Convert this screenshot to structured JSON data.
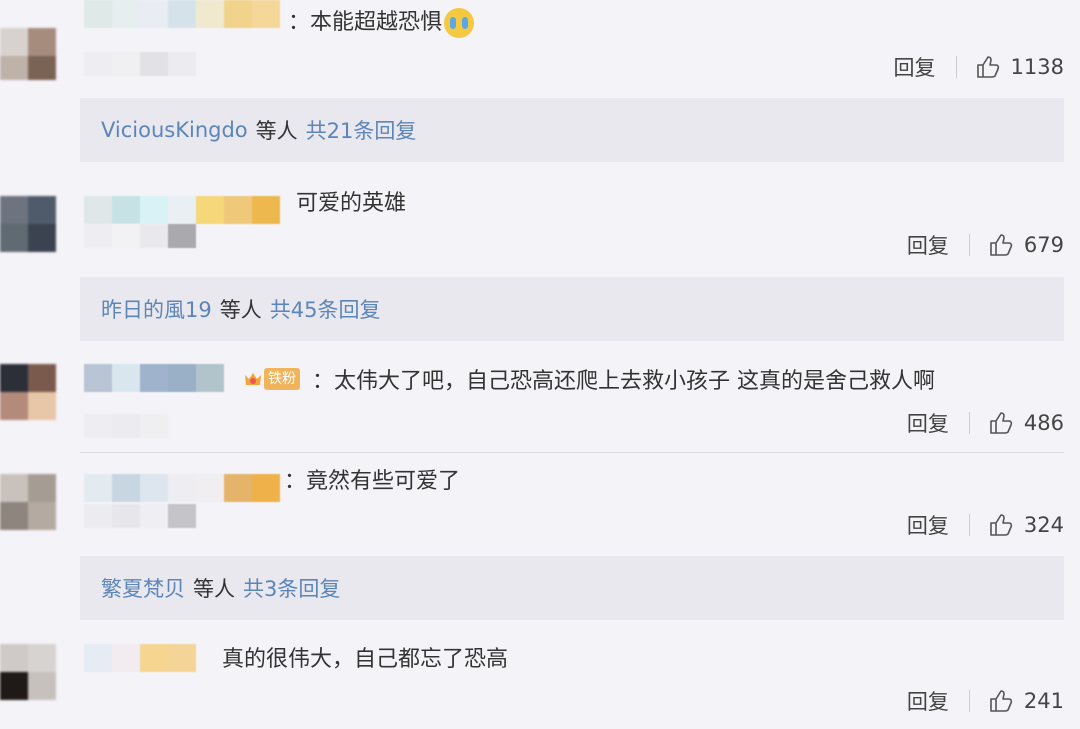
{
  "comments": [
    {
      "text": "：本能超越恐惧",
      "reply": "回复",
      "likes": "1138",
      "emoji": "crying-face"
    },
    {
      "text": "可爱的英雄",
      "reply": "回复",
      "likes": "679"
    },
    {
      "text": "：太伟大了吧，自己恐高还爬上去救小孩子 这真的是舍己救人啊",
      "reply": "回复",
      "likes": "486",
      "badge": "铁粉"
    },
    {
      "text": "：竟然有些可爱了",
      "reply": "回复",
      "likes": "324"
    },
    {
      "text": "真的很伟大，自己都忘了恐高",
      "reply": "回复",
      "likes": "241"
    }
  ],
  "threads": [
    {
      "user": "ViciousKingdo",
      "mid": "等人",
      "count": "共21条回复"
    },
    {
      "user": "昨日的風19",
      "mid": "等人",
      "count": "共45条回复"
    },
    {
      "user": "繁夏梵贝",
      "mid": "等人",
      "count": "共3条回复"
    }
  ],
  "colors": {
    "link": "#5d86b8",
    "background": "#f4f3f8",
    "thread_bg": "#e9e8ee",
    "badge": "#f1b45c"
  },
  "icons": [
    "thumbs-up-icon",
    "crown-icon",
    "crying-face-emoji"
  ]
}
